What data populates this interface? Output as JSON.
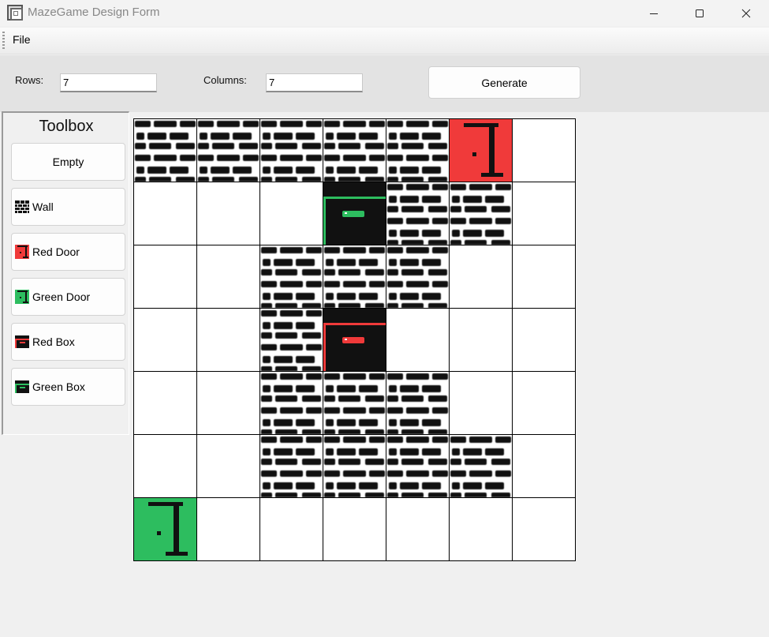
{
  "window": {
    "title": "MazeGame Design Form",
    "icon": "maze-app-icon",
    "controls": [
      "minimize-icon",
      "maximize-icon",
      "close-icon"
    ]
  },
  "menu": {
    "file_label": "File"
  },
  "settings": {
    "rows_label": "Rows:",
    "rows_value": "7",
    "columns_label": "Columns:",
    "columns_value": "7",
    "generate_label": "Generate"
  },
  "toolbox": {
    "title": "Toolbox",
    "items": [
      {
        "label": "Empty",
        "icon": ""
      },
      {
        "label": "Wall",
        "icon": "wall-icon"
      },
      {
        "label": "Red Door",
        "icon": "red-door-icon"
      },
      {
        "label": "Green Door",
        "icon": "green-door-icon"
      },
      {
        "label": "Red Box",
        "icon": "red-box-icon"
      },
      {
        "label": "Green Box",
        "icon": "green-box-icon"
      }
    ]
  },
  "colors": {
    "red": "#f03a3a",
    "green": "#2dbd5f",
    "wall": "#111111"
  },
  "maze": {
    "rows": 7,
    "columns": 7,
    "cells": [
      [
        "wall",
        "wall",
        "wall",
        "wall",
        "wall",
        "red-door",
        "empty"
      ],
      [
        "empty",
        "empty",
        "empty",
        "green-box",
        "wall",
        "wall",
        "empty"
      ],
      [
        "empty",
        "empty",
        "wall",
        "wall",
        "wall",
        "empty",
        "empty"
      ],
      [
        "empty",
        "empty",
        "wall",
        "red-box",
        "empty",
        "empty",
        "empty"
      ],
      [
        "empty",
        "empty",
        "wall",
        "wall",
        "wall",
        "empty",
        "empty"
      ],
      [
        "empty",
        "empty",
        "wall",
        "wall",
        "wall",
        "wall",
        "empty"
      ],
      [
        "green-door",
        "empty",
        "empty",
        "empty",
        "empty",
        "empty",
        "empty"
      ]
    ]
  }
}
